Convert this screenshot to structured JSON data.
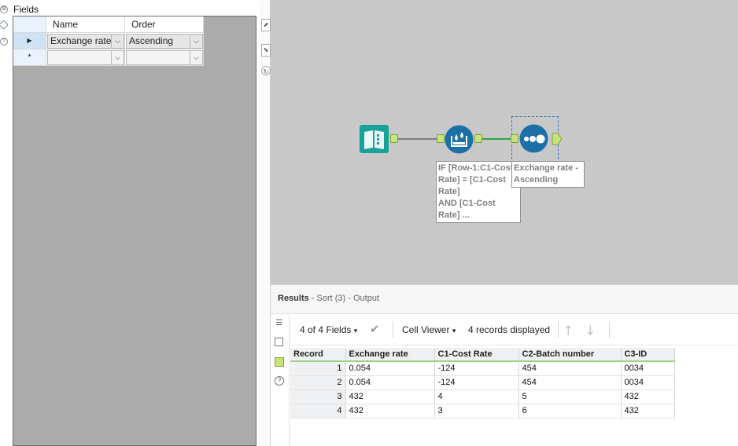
{
  "config": {
    "fields_label": "Fields",
    "columns": [
      "Name",
      "Order"
    ],
    "rows": [
      {
        "selector": "▶",
        "name": "Exchange rate",
        "order": "Ascending"
      },
      {
        "selector": "*",
        "name": "",
        "order": ""
      }
    ]
  },
  "canvas": {
    "filter_label": "IF [Row-1:C1-Cost\nRate] = [C1-Cost\nRate]\nAND [C1-Cost\nRate] ...",
    "sort_label": "Exchange rate -\nAscending",
    "colors": {
      "input_tool": "#1aa198",
      "filter_tool": "#1d6fa8",
      "sort_tool": "#1d6fa8",
      "anchor": "#c9e37b",
      "connection": "#2fa34a"
    }
  },
  "results": {
    "title": "Results",
    "subtitle": " - Sort (3) - Output",
    "toolbar": {
      "fields_count": "4 of 4 Fields",
      "cell_viewer": "Cell Viewer",
      "records_displayed": "4 records displayed"
    },
    "table": {
      "headers": [
        "Record",
        "Exchange rate",
        "C1-Cost Rate",
        "C2-Batch number",
        "C3-ID"
      ],
      "rows": [
        [
          "1",
          "0.054",
          "-124",
          "454",
          "0034"
        ],
        [
          "2",
          "0.054",
          "-124",
          "454",
          "0034"
        ],
        [
          "3",
          "432",
          "4",
          "5",
          "432"
        ],
        [
          "4",
          "432",
          "3",
          "6",
          "432"
        ]
      ]
    }
  }
}
